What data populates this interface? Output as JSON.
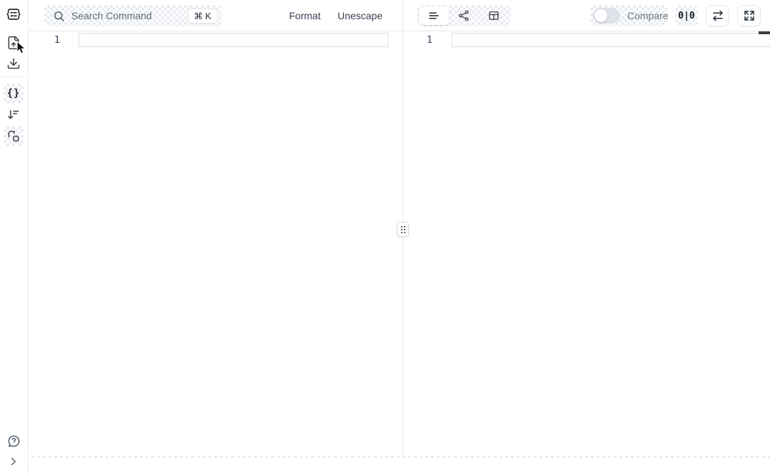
{
  "sidebar": {
    "items": [
      {
        "icon": "app-logo-icon"
      },
      {
        "icon": "file-upload-icon"
      },
      {
        "icon": "download-icon"
      },
      {
        "icon": "braces-icon",
        "glyph": "{}",
        "active": true
      },
      {
        "icon": "sort-icon"
      },
      {
        "icon": "transform-icon",
        "active": true
      }
    ],
    "footer_items": [
      {
        "icon": "help-icon"
      },
      {
        "icon": "expand-sidebar-icon"
      }
    ]
  },
  "toolbar": {
    "search": {
      "placeholder": "Search Command",
      "shortcut": "⌘ K"
    },
    "actions": {
      "format": "Format",
      "unescape": "Unescape"
    },
    "view_switcher": {
      "modes": [
        "text-view",
        "graph-view",
        "table-view"
      ],
      "active": "text-view"
    },
    "compare": {
      "label": "Compare",
      "enabled": false
    },
    "diff_counter": "0|0"
  },
  "editors": {
    "left": {
      "active_line_number": "1",
      "content": ""
    },
    "right": {
      "active_line_number": "1",
      "content": ""
    }
  },
  "colors": {
    "surface_checker": "#e9edf2",
    "border": "#e7eaee",
    "icon": "#3f3f46",
    "line_number": "#32455f",
    "scroll_marker": "#3a3f45"
  }
}
